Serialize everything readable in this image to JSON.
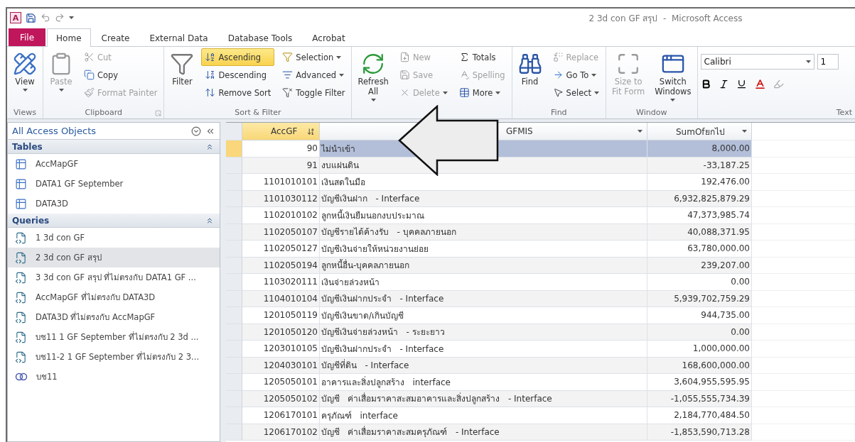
{
  "window": {
    "logo": "A",
    "title": "2 3d con GF สรุป  -  Microsoft Access"
  },
  "ribbon_tabs": [
    {
      "label": "File",
      "kind": "file",
      "selected": false
    },
    {
      "label": "Home",
      "kind": "tab",
      "selected": true
    },
    {
      "label": "Create",
      "kind": "tab",
      "selected": false
    },
    {
      "label": "External Data",
      "kind": "tab",
      "selected": false
    },
    {
      "label": "Database Tools",
      "kind": "tab",
      "selected": false
    },
    {
      "label": "Acrobat",
      "kind": "tab",
      "selected": false
    }
  ],
  "ribbon_groups": [
    {
      "label": "Views",
      "kind": "buttons",
      "launcher": false,
      "columns": [
        [
          {
            "label": "View",
            "kind": "large",
            "dropdown": true,
            "disabled": false,
            "active": false
          }
        ]
      ]
    },
    {
      "label": "Clipboard",
      "kind": "buttons",
      "launcher": true,
      "columns": [
        [
          {
            "label": "Paste",
            "kind": "large",
            "dropdown": true,
            "disabled": true,
            "active": false
          }
        ],
        [
          {
            "label": "Cut",
            "kind": "small",
            "dropdown": false,
            "disabled": true,
            "active": false
          },
          {
            "label": "Copy",
            "kind": "small",
            "dropdown": false,
            "disabled": false,
            "active": false
          },
          {
            "label": "Format Painter",
            "kind": "small",
            "dropdown": false,
            "disabled": true,
            "active": false
          }
        ]
      ]
    },
    {
      "label": "Sort & Filter",
      "kind": "buttons",
      "launcher": false,
      "columns": [
        [
          {
            "label": "Filter",
            "kind": "large",
            "dropdown": false,
            "disabled": false,
            "active": false
          }
        ],
        [
          {
            "label": "Ascending",
            "kind": "small",
            "dropdown": false,
            "disabled": false,
            "active": true
          },
          {
            "label": "Descending",
            "kind": "small",
            "dropdown": false,
            "disabled": false,
            "active": false
          },
          {
            "label": "Remove Sort",
            "kind": "small",
            "dropdown": false,
            "disabled": false,
            "active": false
          }
        ],
        [
          {
            "label": "Selection",
            "kind": "small",
            "dropdown": true,
            "disabled": false,
            "active": false
          },
          {
            "label": "Advanced",
            "kind": "small",
            "dropdown": true,
            "disabled": false,
            "active": false
          },
          {
            "label": "Toggle Filter",
            "kind": "small",
            "dropdown": false,
            "disabled": false,
            "active": false
          }
        ]
      ]
    },
    {
      "kind": "buttons",
      "launcher": false,
      "columns": [
        [
          {
            "label": "Refresh\nAll",
            "kind": "large",
            "dropdown": true,
            "disabled": false,
            "active": false
          }
        ],
        [
          {
            "label": "New",
            "kind": "small",
            "dropdown": false,
            "disabled": true,
            "active": false
          },
          {
            "label": "Save",
            "kind": "small",
            "dropdown": false,
            "disabled": true,
            "active": false
          },
          {
            "label": "Delete",
            "kind": "small",
            "dropdown": true,
            "disabled": true,
            "active": false
          }
        ],
        [
          {
            "label": "Totals",
            "kind": "small",
            "dropdown": false,
            "disabled": false,
            "active": false
          },
          {
            "label": "Spelling",
            "kind": "small",
            "dropdown": false,
            "disabled": true,
            "active": false
          },
          {
            "label": "More",
            "kind": "small",
            "dropdown": true,
            "disabled": false,
            "active": false
          }
        ]
      ]
    },
    {
      "label": "Find",
      "kind": "buttons",
      "launcher": false,
      "columns": [
        [
          {
            "label": "Find",
            "kind": "large",
            "dropdown": false,
            "disabled": false,
            "active": false
          }
        ],
        [
          {
            "label": "Replace",
            "kind": "small",
            "dropdown": false,
            "disabled": true,
            "active": false
          },
          {
            "label": "Go To",
            "kind": "small",
            "dropdown": true,
            "disabled": false,
            "active": false
          },
          {
            "label": "Select",
            "kind": "small",
            "dropdown": true,
            "disabled": false,
            "active": false
          }
        ]
      ]
    },
    {
      "label": "Window",
      "kind": "buttons",
      "launcher": false,
      "columns": [
        [
          {
            "label": "Size to\nFit Form",
            "kind": "large",
            "dropdown": false,
            "disabled": true,
            "active": false
          }
        ],
        [
          {
            "label": "Switch\nWindows",
            "kind": "large",
            "dropdown": true,
            "disabled": false,
            "active": false
          }
        ]
      ]
    },
    {
      "label": "Text",
      "kind": "format",
      "font": "Calibri",
      "size": "1"
    }
  ],
  "nav_pane": {
    "title": "All Access Objects",
    "groups": [
      {
        "label": "Tables",
        "expanded": true,
        "items": [
          {
            "label": "AccMapGF",
            "kind": "table",
            "selected": false
          },
          {
            "label": "DATA1 GF September",
            "kind": "table",
            "selected": false
          },
          {
            "label": "DATA3D",
            "kind": "table",
            "selected": false
          }
        ]
      },
      {
        "label": "Queries",
        "expanded": true,
        "items": [
          {
            "label": "1 3d con GF",
            "kind": "query",
            "selected": false
          },
          {
            "label": "2 3d con GF สรุป",
            "kind": "query",
            "selected": true
          },
          {
            "label": "3 3d con GF สรุป ที่ไม่ตรงกับ DATA1 GF ...",
            "kind": "query",
            "selected": false
          },
          {
            "label": "AccMapGF ที่ไม่ตรงกับ DATA3D",
            "kind": "query",
            "selected": false
          },
          {
            "label": "DATA3D ที่ไม่ตรงกับ AccMapGF",
            "kind": "query",
            "selected": false
          },
          {
            "label": "บช11 1 GF September ที่ไม่ตรงกับ 2 3d ...",
            "kind": "query",
            "selected": false
          },
          {
            "label": "บช11-2 1 GF September ที่ไม่ตรงกับ 2 3...",
            "kind": "query",
            "selected": false
          },
          {
            "label": "บช11",
            "kind": "union",
            "selected": false
          }
        ]
      }
    ]
  },
  "table": {
    "columns": [
      {
        "label": "AccGF",
        "sorted": true
      },
      {
        "label": "GFMIS",
        "sorted": false
      },
      {
        "label": "SumOfยกไป",
        "sorted": false
      }
    ],
    "rows": [
      {
        "acc": "90",
        "name": "ไม่นำเข้า",
        "sum": "8,000.00",
        "selected": true
      },
      {
        "acc": "91",
        "name": "งบแผ่นดิน",
        "sum": "-33,187.25",
        "selected": false
      },
      {
        "acc": "1101010101",
        "name": "เงินสดในมือ",
        "sum": "192,476.00",
        "selected": false
      },
      {
        "acc": "1101030112",
        "name": "บัญชีเงินฝาก   - Interface",
        "sum": "6,932,825,879.29",
        "selected": false
      },
      {
        "acc": "1102010102",
        "name": "ลูกหนี้เงินยืมนอกงบประมาณ",
        "sum": "47,373,985.74",
        "selected": false
      },
      {
        "acc": "1102050107",
        "name": "บัญชีรายได้ค้างรับ   - บุคคลภายนอก",
        "sum": "40,088,371.95",
        "selected": false
      },
      {
        "acc": "1102050127",
        "name": "บัญชีเงินจ่ายให้หน่วยงานย่อย",
        "sum": "63,780,000.00",
        "selected": false
      },
      {
        "acc": "1102050194",
        "name": "ลูกหนี้อื่น-บุคคลภายนอก",
        "sum": "239,207.00",
        "selected": false
      },
      {
        "acc": "1103020111",
        "name": "เงินจ่ายล่วงหน้า",
        "sum": "0.00",
        "selected": false
      },
      {
        "acc": "1104010104",
        "name": "บัญชีเงินฝากประจำ   - Interface",
        "sum": "5,939,702,759.29",
        "selected": false
      },
      {
        "acc": "1201050119",
        "name": "บัญชีเงินขาด/เกินบัญชี",
        "sum": "944,735.00",
        "selected": false
      },
      {
        "acc": "1201050120",
        "name": "บัญชีเงินจ่ายล่วงหน้า   - ระยะยาว",
        "sum": "0.00",
        "selected": false
      },
      {
        "acc": "1203010105",
        "name": "บัญชีเงินฝากประจำ   - Interface",
        "sum": "1,000,000.00",
        "selected": false
      },
      {
        "acc": "1204030101",
        "name": "บัญชีที่ดิน   - Interface",
        "sum": "168,600,000.00",
        "selected": false
      },
      {
        "acc": "1205050101",
        "name": "อาคารและสิ่งปลูกสร้าง   interface",
        "sum": "3,604,955,595.95",
        "selected": false
      },
      {
        "acc": "1205050102",
        "name": "บัญชี   ค่าเสื่อมราคาสะสมอาคารและสิ่งปลูกสร้าง   - Interface",
        "sum": "-1,055,555,734.39",
        "selected": false
      },
      {
        "acc": "1206170101",
        "name": "ครุภัณฑ์   interface",
        "sum": "2,184,770,484.50",
        "selected": false
      },
      {
        "acc": "1206170102",
        "name": "บัญชี   ค่าเสื่อมราคาสะสมครุภัณฑ์   - Interface",
        "sum": "-1,853,590,713.28",
        "selected": false
      }
    ]
  }
}
